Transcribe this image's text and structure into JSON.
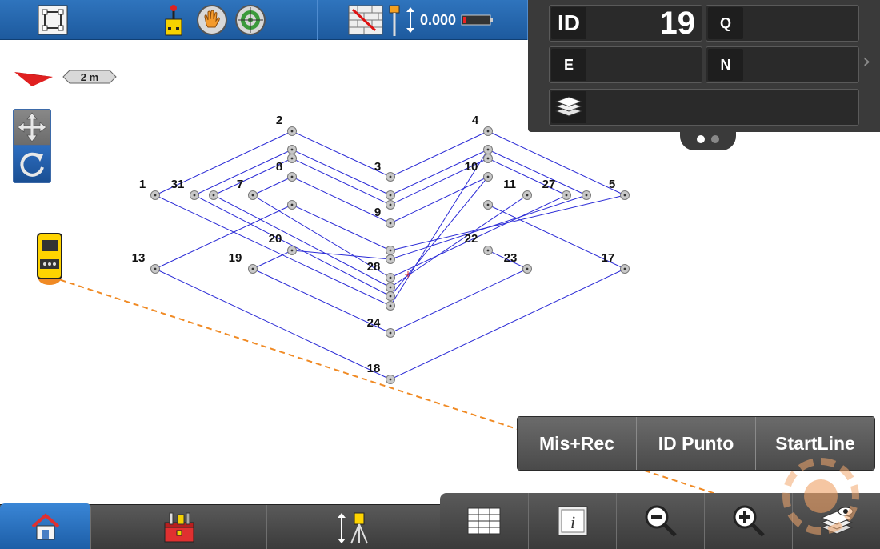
{
  "topbar": {
    "value_label": "0.000",
    "icons": [
      "select-frame-icon",
      "joystick-icon",
      "hand-icon",
      "target-icon",
      "brick-wall-icon",
      "prism-pole-icon",
      "height-arrow-icon",
      "battery-icon"
    ]
  },
  "info_panel": {
    "id_tag": "ID",
    "id_value": "19",
    "q_tag": "Q",
    "q_value": "",
    "e_tag": "E",
    "e_value": "",
    "n_tag": "N",
    "n_value": "",
    "layers_value": "",
    "page_count": 2,
    "active_page": 1
  },
  "map": {
    "scale_label": "2 m",
    "point_labels": [
      "1",
      "2",
      "3",
      "4",
      "5",
      "7",
      "8",
      "9",
      "10",
      "11",
      "13",
      "17",
      "18",
      "19",
      "20",
      "22",
      "23",
      "24",
      "27",
      "28",
      "31"
    ]
  },
  "actions": {
    "measure_record": "Mis+Rec",
    "point_id": "ID Punto",
    "start_line": "StartLine"
  },
  "colors": {
    "topbar_blue": "#2f74bd",
    "line_blue": "#2b2bd6",
    "sight_line": "#f08a24",
    "panel_dark": "#3a3a3a"
  }
}
